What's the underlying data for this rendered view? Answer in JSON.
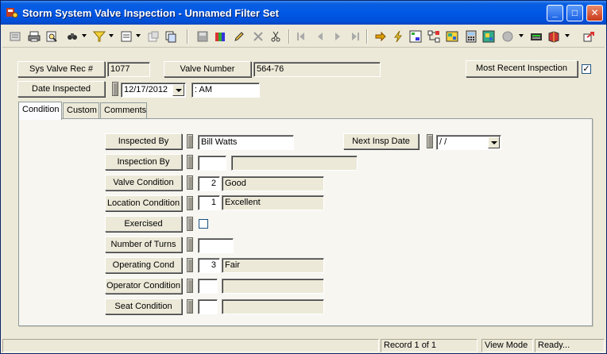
{
  "window": {
    "title": "Storm System Valve Inspection - Unnamed Filter Set",
    "controls": {
      "minimize": "_",
      "maximize": "□",
      "close": "✕"
    }
  },
  "toolbar": {
    "icons": [
      "record-icon",
      "print-icon",
      "print-preview-icon",
      "find-icon",
      "filter-icon",
      "form-view-icon",
      "properties-icon",
      "copy-record-icon",
      "save-icon",
      "books-icon",
      "edit-pencil-icon",
      "delete-icon",
      "cut-icon",
      "first-record-icon",
      "previous-record-icon",
      "next-record-icon",
      "last-record-icon",
      "goto-icon",
      "lightning-icon",
      "tree-icon",
      "hierarchy-icon",
      "map-icon",
      "calculator-icon",
      "map-grid-icon",
      "globe-icon",
      "keyboard-icon",
      "book-icon",
      "exit-icon"
    ]
  },
  "header": {
    "sys_valve_rec_label": "Sys Valve Rec #",
    "sys_valve_rec_value": "1077",
    "valve_number_label": "Valve Number",
    "valve_number_value": "564-76",
    "most_recent_label": "Most Recent Inspection",
    "most_recent_checked": "✓",
    "date_inspected_label": "Date Inspected",
    "date_inspected_value": "12/17/2012",
    "time_value": "  :  AM"
  },
  "tabs": [
    {
      "label": "Condition"
    },
    {
      "label": "Custom"
    },
    {
      "label": "Comments"
    }
  ],
  "form": {
    "inspected_by": {
      "label": "Inspected By",
      "value": "Bill Watts"
    },
    "inspection_by": {
      "label": "Inspection By",
      "code": "",
      "desc": ""
    },
    "valve_condition": {
      "label": "Valve Condition",
      "code": "2",
      "desc": "Good"
    },
    "location_condition": {
      "label": "Location Condition",
      "code": "1",
      "desc": "Excellent"
    },
    "exercised": {
      "label": "Exercised",
      "checked": ""
    },
    "number_of_turns": {
      "label": "Number of Turns",
      "value": ""
    },
    "operating_cond": {
      "label": "Operating Cond",
      "code": "3",
      "desc": "Fair"
    },
    "operator_condition": {
      "label": "Operator Condition",
      "code": "",
      "desc": ""
    },
    "seat_condition": {
      "label": "Seat Condition",
      "code": "",
      "desc": ""
    },
    "next_insp_date": {
      "label": "Next Insp Date",
      "value": " /  /"
    }
  },
  "status": {
    "record": "Record 1 of 1",
    "mode": "View Mode",
    "state": "Ready..."
  },
  "colors": {
    "titlebar": "#0058e6",
    "window_bg": "#ece9d8"
  }
}
